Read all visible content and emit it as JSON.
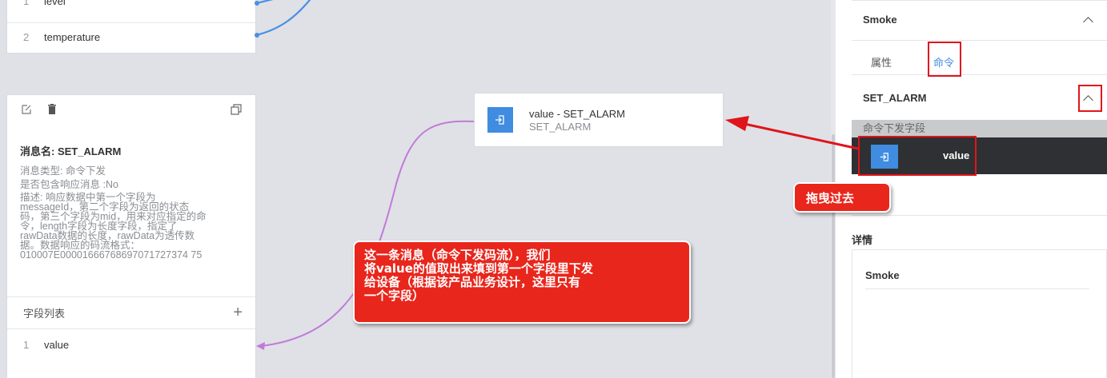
{
  "canvas": {
    "top_fields": [
      {
        "index": "1",
        "name": "level"
      },
      {
        "index": "2",
        "name": "temperature"
      }
    ],
    "message_card": {
      "name_line": "消息名: SET_ALARM",
      "type_line": "消息类型: 命令下发",
      "response_line": "是否包含响应消息 :No",
      "description_lines": [
        "描述: 响应数据中第一个字段为",
        "messageId，第二个字段为返回的状态",
        "码，第三个字段为mid，用来对应指定的命",
        "令，length字段为长度字段，指定了",
        "rawData数据的长度，rawData为透传数",
        "据。数据响应的码流格式：",
        "010007E00001666768697071727374 75"
      ],
      "field_list_label": "字段列表",
      "fields": [
        {
          "index": "1",
          "name": "value"
        }
      ]
    },
    "value_node": {
      "title": "value - SET_ALARM",
      "subtitle": "SET_ALARM"
    }
  },
  "panel": {
    "device_name": "Smoke",
    "tabs": [
      "属性",
      "命令"
    ],
    "active_tab": "命令",
    "command_name": "SET_ALARM",
    "command_fields_label": "命令下发字段",
    "command_fields": [
      "value"
    ],
    "details_label": "详情",
    "details_title": "Smoke"
  },
  "annotations": {
    "drag_hint": "拖曳过去",
    "note_lines": [
      "这一条消息（命令下发码流），我们",
      "将value的值取出来填到第一个字段里下发",
      "给设备（根据该产品业务设计，这里只有",
      "一个字段）"
    ]
  },
  "colors": {
    "accent": "#3f8ce0",
    "annotation_red": "#e8261c",
    "link_blue": "#4a90e2",
    "link_purple": "#c27ad8"
  }
}
